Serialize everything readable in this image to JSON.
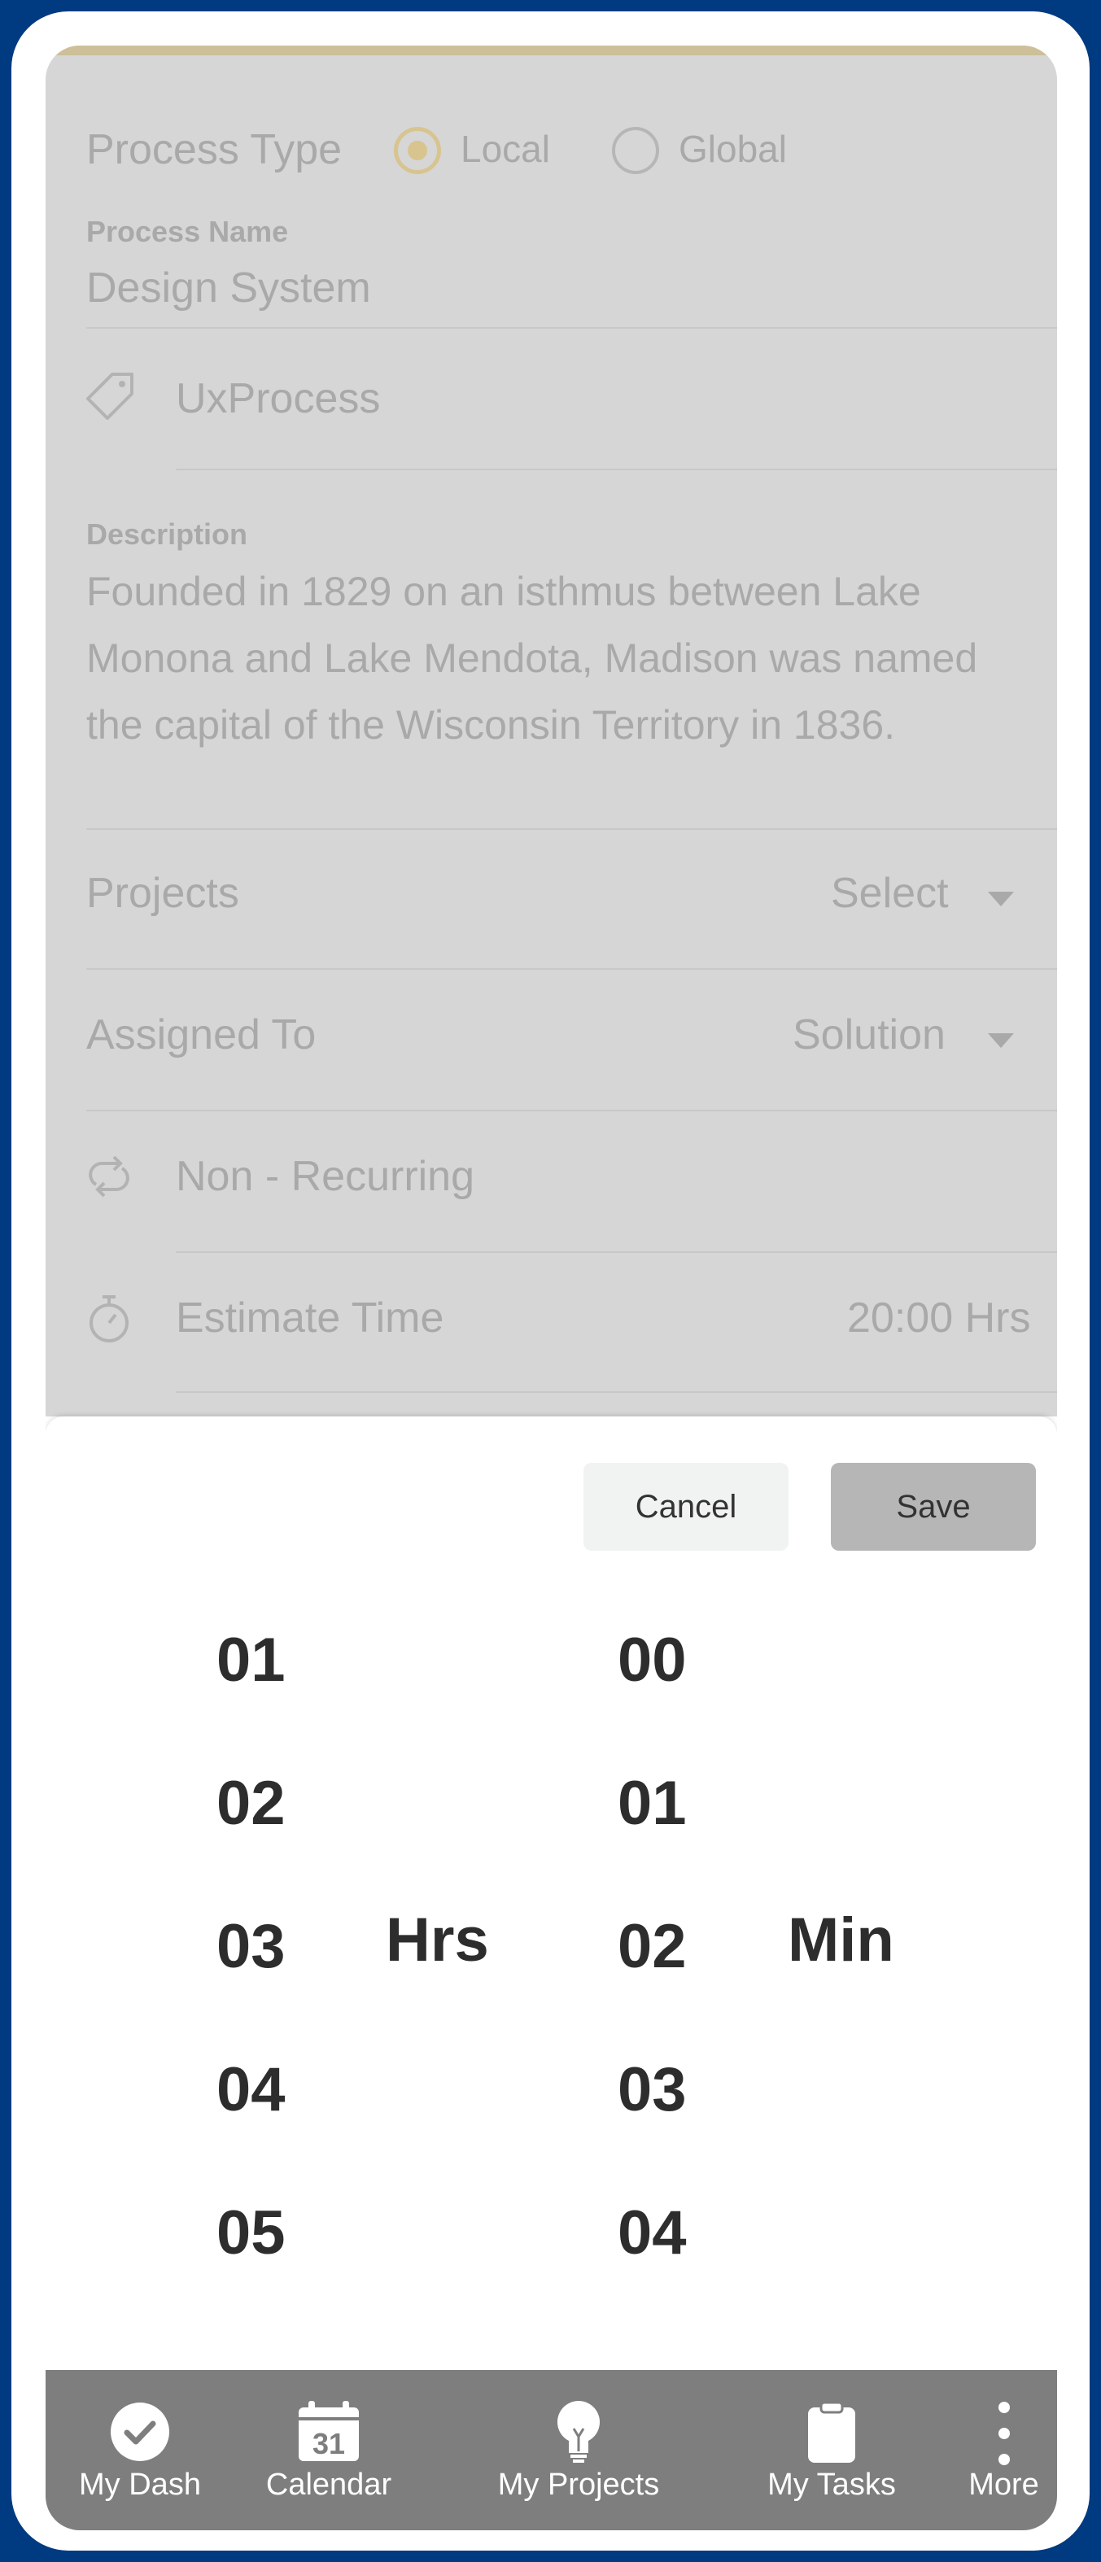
{
  "form": {
    "process_type": {
      "label": "Process Type",
      "options": [
        {
          "label": "Local",
          "selected": true
        },
        {
          "label": "Global",
          "selected": false
        }
      ]
    },
    "process_name": {
      "label": "Process Name",
      "value": "Design System"
    },
    "tag": {
      "icon": "tag-icon",
      "value": "UxProcess"
    },
    "description": {
      "label": "Description",
      "value": "Founded in 1829 on an isthmus between Lake Monona and Lake Mendota, Madison was named the capital of the Wisconsin Territory in 1836."
    },
    "projects": {
      "label": "Projects",
      "value": "Select"
    },
    "assigned_to": {
      "label": "Assigned To",
      "value": "Solution"
    },
    "recurrence": {
      "icon": "repeat-icon",
      "value": "Non - Recurring"
    },
    "estimate_time": {
      "icon": "stopwatch-icon",
      "label": "Estimate Time",
      "value": "20:00 Hrs"
    }
  },
  "picker": {
    "cancel_label": "Cancel",
    "save_label": "Save",
    "hours": [
      "01",
      "02",
      "03",
      "04",
      "05"
    ],
    "hours_unit": "Hrs",
    "minutes": [
      "00",
      "01",
      "02",
      "03",
      "04"
    ],
    "minutes_unit": "Min"
  },
  "tabbar": {
    "items": [
      {
        "label": "My Dash",
        "icon": "check-circle-icon"
      },
      {
        "label": "Calendar",
        "icon": "calendar-icon",
        "icon_text": "31"
      },
      {
        "label": "My Projects",
        "icon": "lightbulb-icon"
      },
      {
        "label": "My Tasks",
        "icon": "clipboard-icon"
      },
      {
        "label": "More",
        "icon": "more-vertical-icon"
      }
    ]
  },
  "colors": {
    "frame": "#003a80",
    "accent": "#d8c48e",
    "overlay": "#d6d6d6",
    "tabbar": "#7e7e7e"
  }
}
